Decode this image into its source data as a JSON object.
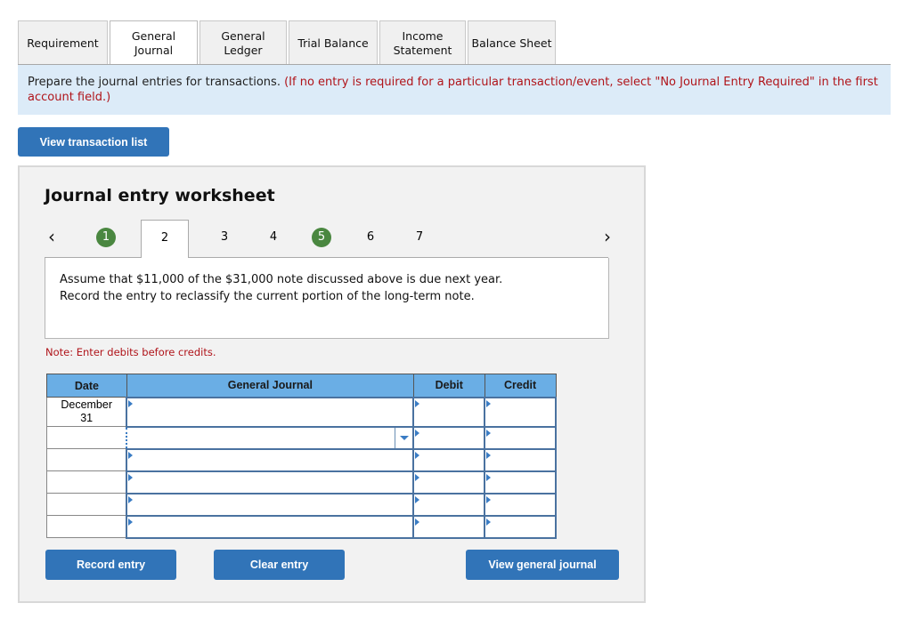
{
  "tabs": [
    {
      "label": "Requirement",
      "active": false
    },
    {
      "label": "General Journal",
      "active": true
    },
    {
      "label": "General Ledger",
      "active": false
    },
    {
      "label": "Trial Balance",
      "active": false
    },
    {
      "label": "Income Statement",
      "active": false
    },
    {
      "label": "Balance Sheet",
      "active": false
    }
  ],
  "instructions": {
    "main": "Prepare the journal entries for transactions.",
    "highlight": "(If no entry is required for a particular transaction/event, select \"No Journal Entry Required\" in the first account field.)"
  },
  "view_transaction_list_label": "View transaction list",
  "worksheet": {
    "title": "Journal entry worksheet",
    "prev_icon": "‹",
    "next_icon": "›",
    "pages": [
      {
        "label": "1",
        "status": "completed"
      },
      {
        "label": "2",
        "status": "current"
      },
      {
        "label": "3",
        "status": "pending"
      },
      {
        "label": "4",
        "status": "pending"
      },
      {
        "label": "5",
        "status": "completed"
      },
      {
        "label": "6",
        "status": "pending"
      },
      {
        "label": "7",
        "status": "pending"
      }
    ],
    "description_line1": "Assume that $11,000 of the $31,000 note discussed above is due next year.",
    "description_line2": "Record the entry to reclassify the current portion of the long-term note.",
    "note": "Note: Enter debits before credits."
  },
  "journal_table": {
    "headers": {
      "date": "Date",
      "account": "General Journal",
      "debit": "Debit",
      "credit": "Credit"
    },
    "rows": [
      {
        "date_line1": "December",
        "date_line2": "31",
        "account": "",
        "debit": "",
        "credit": ""
      },
      {
        "date_line1": "",
        "date_line2": "",
        "account": "",
        "debit": "",
        "credit": ""
      },
      {
        "date_line1": "",
        "date_line2": "",
        "account": "",
        "debit": "",
        "credit": ""
      },
      {
        "date_line1": "",
        "date_line2": "",
        "account": "",
        "debit": "",
        "credit": ""
      },
      {
        "date_line1": "",
        "date_line2": "",
        "account": "",
        "debit": "",
        "credit": ""
      },
      {
        "date_line1": "",
        "date_line2": "",
        "account": "",
        "debit": "",
        "credit": ""
      }
    ]
  },
  "buttons": {
    "record": "Record entry",
    "clear": "Clear entry",
    "view_general_journal": "View general journal"
  },
  "colors": {
    "primary_button": "#3174b8",
    "banner_bg": "#dcebf8",
    "instruction_red": "#b0141a",
    "completed_green": "#4a8740",
    "table_header": "#6aaee5"
  }
}
